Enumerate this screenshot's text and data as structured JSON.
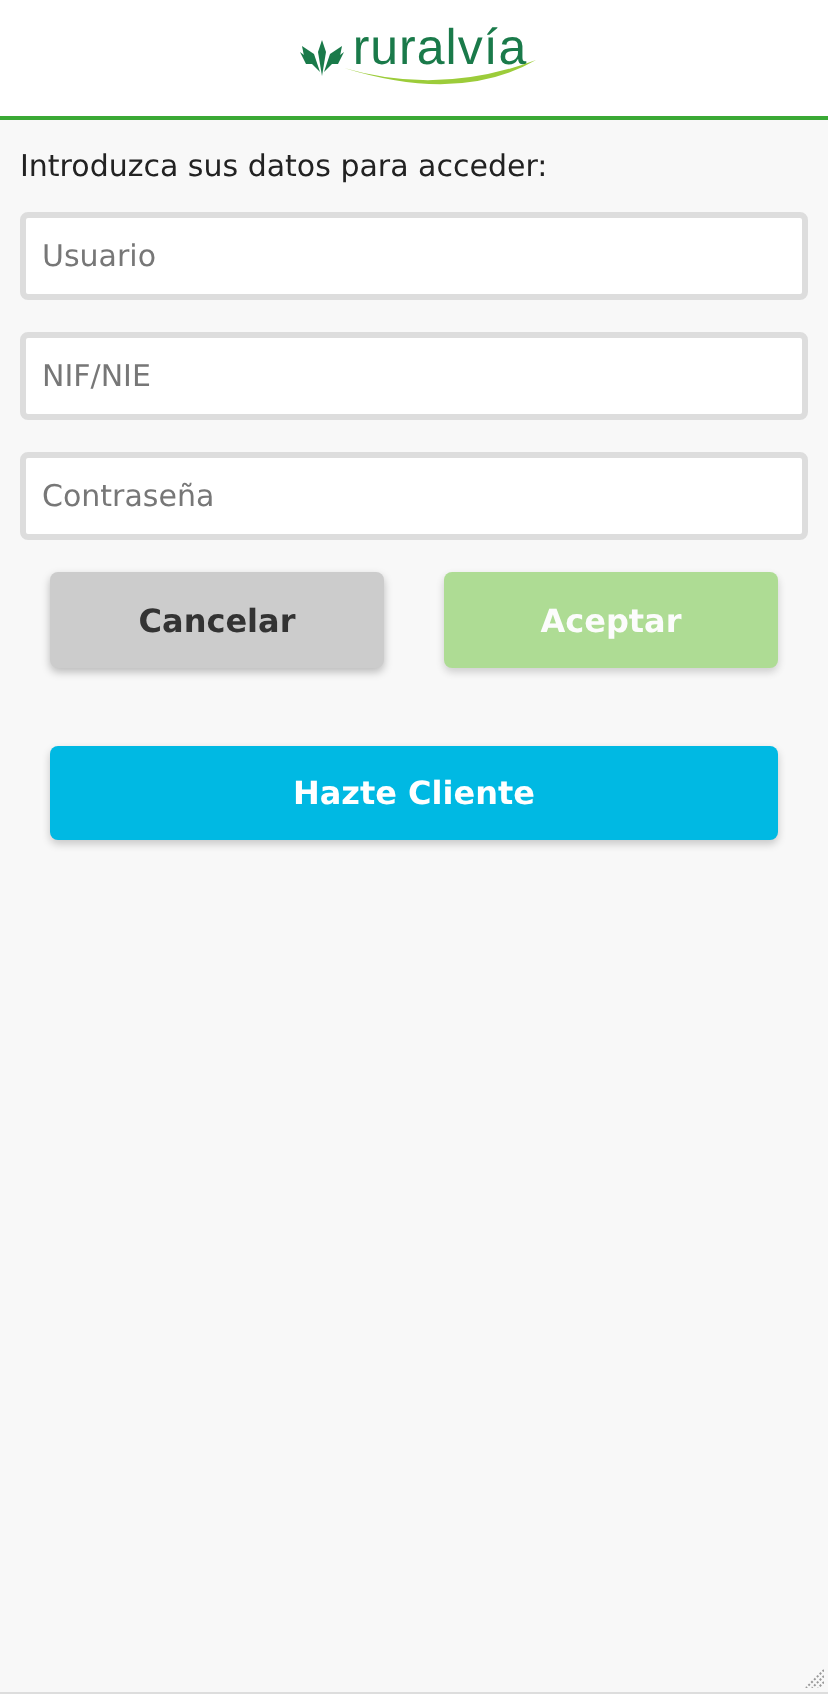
{
  "header": {
    "logo_text": "ruralvía"
  },
  "intro": "Introduzca sus datos para acceder:",
  "fields": [
    {
      "placeholder": "Usuario"
    },
    {
      "placeholder": "NIF/NIE"
    },
    {
      "placeholder": "Contraseña"
    }
  ],
  "buttons": [
    {
      "label": "Cancelar",
      "kind": "secondary",
      "disabled": false
    },
    {
      "label": "Aceptar",
      "kind": "primary",
      "disabled": true
    }
  ],
  "signup_button": {
    "label": "Hazte Cliente"
  }
}
